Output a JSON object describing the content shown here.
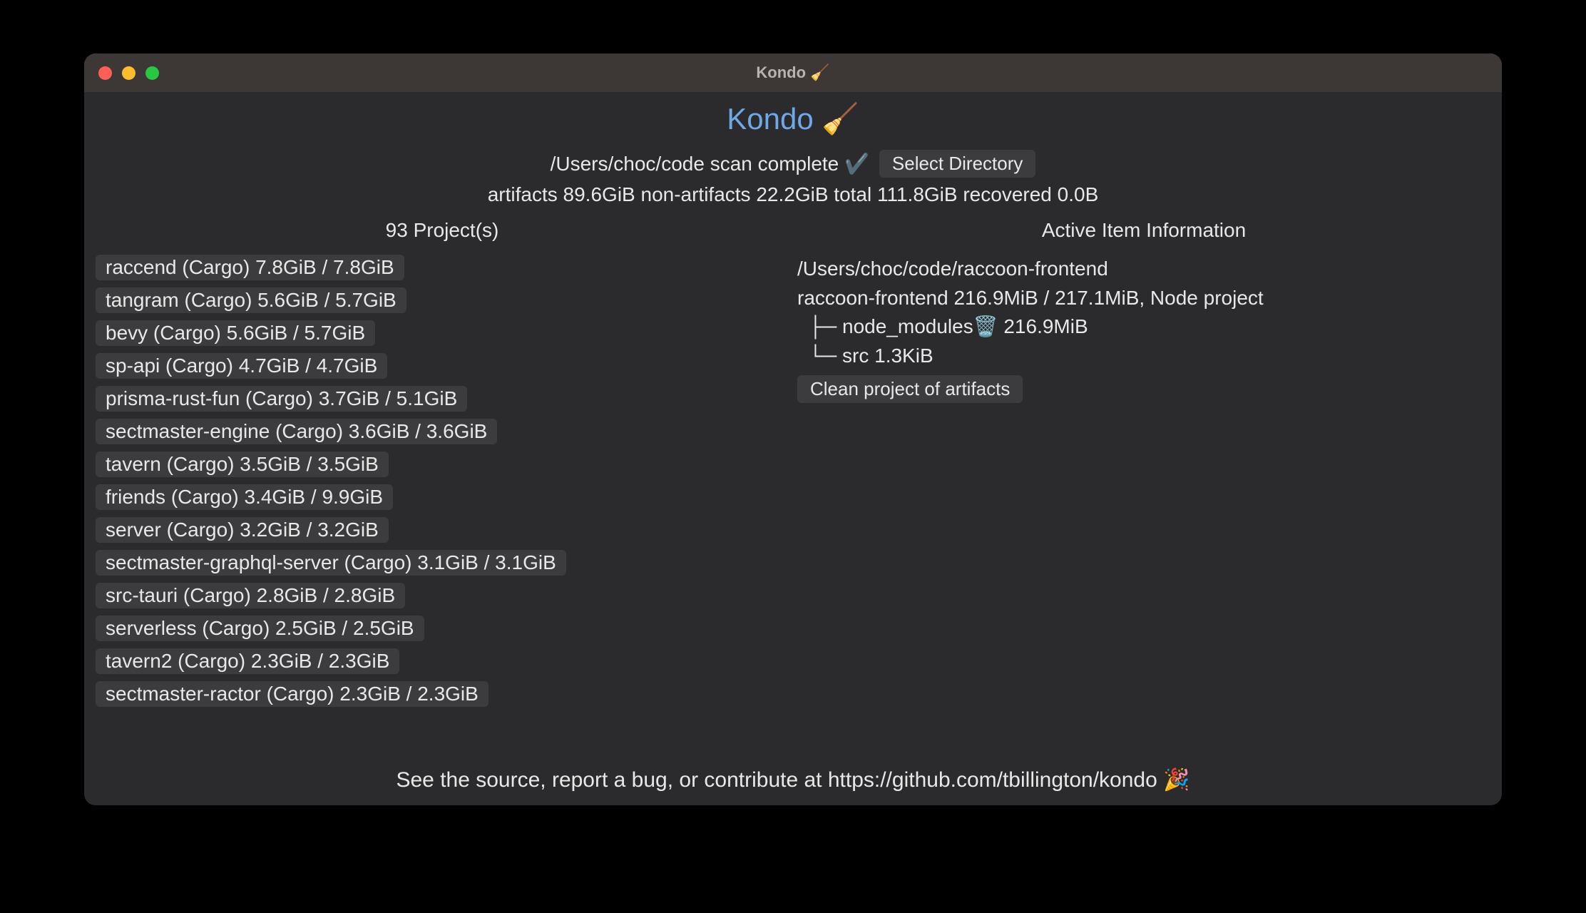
{
  "window": {
    "title": "Kondo 🧹"
  },
  "header": {
    "app_title": "Kondo 🧹",
    "scan_status": "/Users/choc/code scan complete ✔️",
    "select_dir_label": "Select Directory",
    "stats": "artifacts 89.6GiB non-artifacts 22.2GiB total 111.8GiB recovered 0.0B"
  },
  "left": {
    "header": "93 Project(s)",
    "projects": [
      "raccend (Cargo) 7.8GiB / 7.8GiB",
      "tangram (Cargo) 5.6GiB / 5.7GiB",
      "bevy (Cargo) 5.6GiB / 5.7GiB",
      "sp-api (Cargo) 4.7GiB / 4.7GiB",
      "prisma-rust-fun (Cargo) 3.7GiB / 5.1GiB",
      "sectmaster-engine (Cargo) 3.6GiB / 3.6GiB",
      "tavern (Cargo) 3.5GiB / 3.5GiB",
      "friends (Cargo) 3.4GiB / 9.9GiB",
      "server (Cargo) 3.2GiB / 3.2GiB",
      "sectmaster-graphql-server (Cargo) 3.1GiB / 3.1GiB",
      "src-tauri (Cargo) 2.8GiB / 2.8GiB",
      "serverless (Cargo) 2.5GiB / 2.5GiB",
      "tavern2 (Cargo) 2.3GiB / 2.3GiB",
      "sectmaster-ractor (Cargo) 2.3GiB / 2.3GiB"
    ]
  },
  "right": {
    "header": "Active Item Information",
    "path": "/Users/choc/code/raccoon-frontend",
    "summary": "raccoon-frontend 216.9MiB / 217.1MiB, Node project",
    "tree1": "  ├─ node_modules🗑️ 216.9MiB",
    "tree2": "  └─ src 1.3KiB",
    "clean_label": "Clean project of artifacts"
  },
  "footer": {
    "text": "See the source, report a bug, or contribute at https://github.com/tbillington/kondo 🎉"
  }
}
